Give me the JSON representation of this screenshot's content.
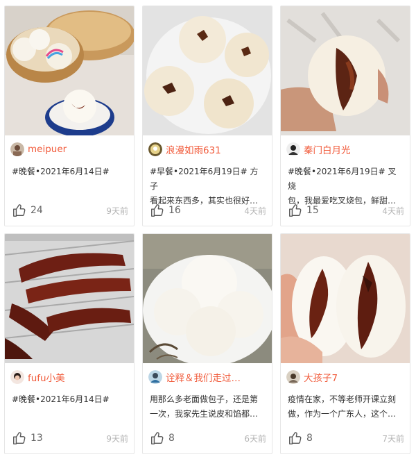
{
  "cards": [
    {
      "author": "meipuer",
      "text": "#晚餐•2021年6月14日#",
      "likes": "24",
      "time": "9天前",
      "photo_icon": "steamed-buns-in-basket"
    },
    {
      "author": "浪漫如雨631",
      "text": "#早餐•2021年6月19日# 方子\n看起来东西多，其实也很好…",
      "likes": "16",
      "time": "4天前",
      "photo_icon": "four-open-buns-on-plate"
    },
    {
      "author": "秦门白月光",
      "text": "#晚餐•2021年6月19日# 叉烧\n包，我最爱吃叉烧包，鲜甜…",
      "likes": "15",
      "time": "4天前",
      "photo_icon": "bun-held-in-hand"
    },
    {
      "author": "fufu小美",
      "text": "#晚餐•2021年6月14日#",
      "likes": "13",
      "time": "9天前",
      "photo_icon": "char-siu-on-foil-tray"
    },
    {
      "author": "诠释＆我们走过…",
      "text": "用那么多老面做包子，还是第\n一次，我家先生说皮和馅都…",
      "likes": "8",
      "time": "6天前",
      "photo_icon": "plain-buns-on-plate"
    },
    {
      "author": "大孩子7",
      "text": "疫情在家，不等老师开课立刻\n做，作为一个广东人，这个…",
      "likes": "8",
      "time": "7天前",
      "photo_icon": "bun-split-open"
    }
  ],
  "colors": {
    "author": "#f15a3a",
    "time": "#b4b4b4",
    "border": "#e6e6e6"
  },
  "icons": {
    "like": "thumbs-up-icon"
  }
}
